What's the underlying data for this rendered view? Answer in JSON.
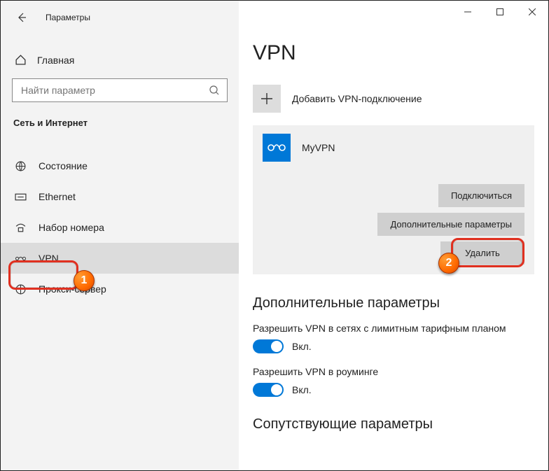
{
  "window": {
    "title": "Параметры"
  },
  "sidebar": {
    "home_label": "Главная",
    "search_placeholder": "Найти параметр",
    "section": "Сеть и Интернет",
    "items": [
      {
        "label": "Состояние"
      },
      {
        "label": "Ethernet"
      },
      {
        "label": "Набор номера"
      },
      {
        "label": "VPN"
      },
      {
        "label": "Прокси-сервер"
      }
    ],
    "active_index": 3
  },
  "main": {
    "title": "VPN",
    "add_label": "Добавить VPN-подключение",
    "vpn": {
      "name": "MyVPN",
      "connect": "Подключиться",
      "advanced": "Дополнительные параметры",
      "delete": "Удалить"
    },
    "section_advanced": "Дополнительные параметры",
    "toggle1_label": "Разрешить VPN в сетях с лимитным тарифным планом",
    "toggle2_label": "Разрешить VPN в роуминге",
    "on_text": "Вкл.",
    "section_related": "Сопутствующие параметры"
  },
  "annotations": {
    "n1": "1",
    "n2": "2"
  }
}
